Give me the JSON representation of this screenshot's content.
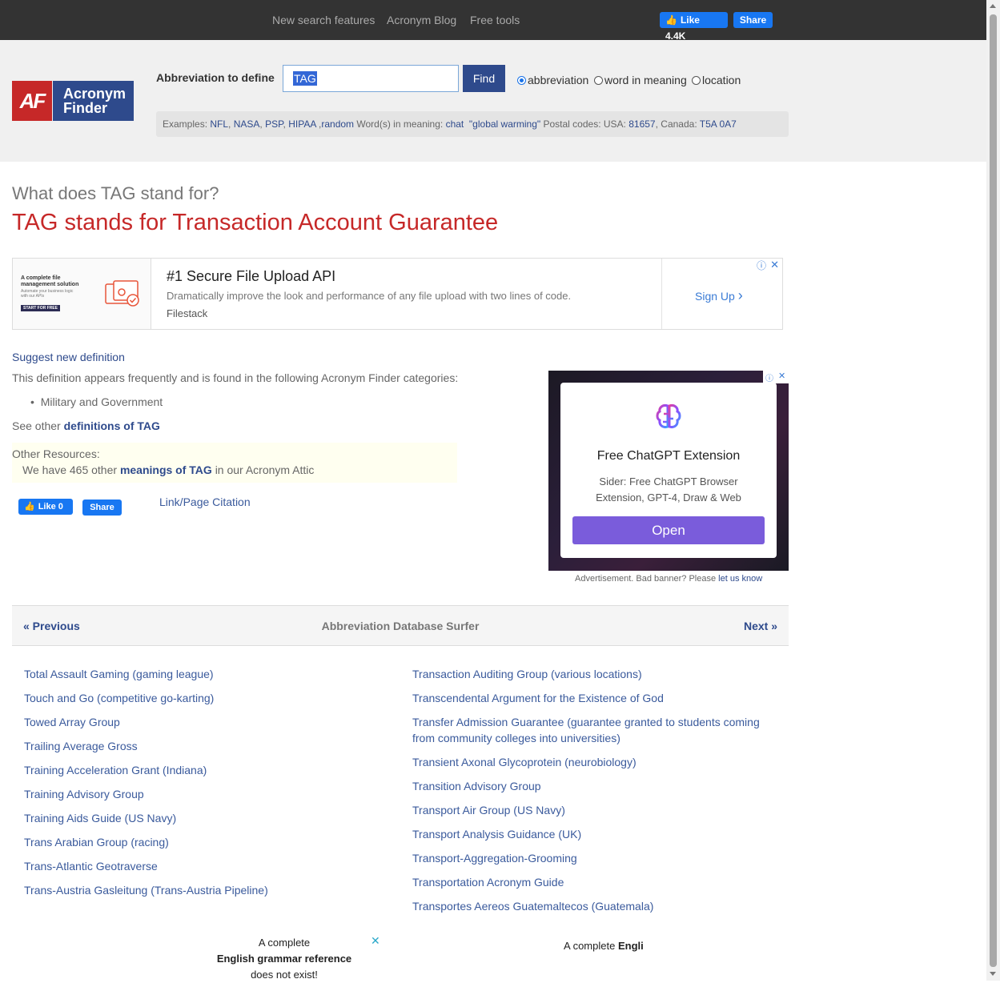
{
  "topnav": {
    "links": [
      "New search features",
      "Acronym Blog",
      "Free tools"
    ],
    "like_label": "Like 4.4K",
    "share_label": "Share"
  },
  "logo": {
    "mark": "AF",
    "name_line1": "Acronym",
    "name_line2": "Finder"
  },
  "search": {
    "label": "Abbreviation to define",
    "value": "TAG",
    "find_label": "Find",
    "radios": [
      {
        "label": "abbreviation",
        "checked": true
      },
      {
        "label": "word in meaning",
        "checked": false
      },
      {
        "label": "location",
        "checked": false
      }
    ],
    "examples": {
      "prefix": "Examples:",
      "abbr": [
        "NFL",
        "NASA",
        "PSP",
        "HIPAA"
      ],
      "random": "random",
      "meaning_prefix": "Word(s) in meaning:",
      "meaning": [
        "chat",
        "\"global warming\""
      ],
      "postal_prefix": "Postal codes: USA:",
      "usa_code": "81657",
      "canada_prefix": "Canada:",
      "canada_code": "T5A 0A7"
    }
  },
  "page": {
    "question": "What does TAG stand for?",
    "answer": "TAG stands for Transaction Account Guarantee",
    "suggest_link": "Suggest new definition",
    "categories_text": "This definition appears frequently and is found in the following Acronym Finder categories:",
    "categories": [
      "Military and Government"
    ],
    "see_other_prefix": "See other",
    "see_other_link": "definitions of TAG",
    "other_resources_label": "Other Resources:",
    "other_resources_prefix": "We have 465 other",
    "other_resources_link": "meanings of TAG",
    "other_resources_suffix": "in our Acronym Attic",
    "like_label": "Like 0",
    "share_label": "Share",
    "citation_link": "Link/Page Citation"
  },
  "ad1": {
    "thumb_text": "A complete file management solution",
    "thumb_sub": "Automate your business logic with our APIs",
    "thumb_button": "START FOR FREE",
    "title": "#1 Secure File Upload API",
    "description": "Dramatically improve the look and performance of any file upload with two lines of code.",
    "sponsor": "Filestack",
    "cta": "Sign Up"
  },
  "ad2": {
    "title": "Free ChatGPT Extension",
    "description": "Sider: Free ChatGPT Browser Extension, GPT-4, Draw & Web",
    "button": "Open",
    "notice_prefix": "Advertisement. Bad banner? Please",
    "notice_link": "let us know"
  },
  "surfer": {
    "prev": "« Previous",
    "title": "Abbreviation Database Surfer",
    "next": "Next »"
  },
  "list_left": [
    "Total Assault Gaming (gaming league)",
    "Touch and Go (competitive go-karting)",
    "Towed Array Group",
    "Trailing Average Gross",
    "Training Acceleration Grant (Indiana)",
    "Training Advisory Group",
    "Training Aids Guide (US Navy)",
    "Trans Arabian Group (racing)",
    "Trans-Atlantic Geotraverse",
    "Trans-Austria Gasleitung (Trans-Austria Pipeline)"
  ],
  "list_right": [
    "Transaction Auditing Group (various locations)",
    "Transcendental Argument for the Existence of God",
    "Transfer Admission Guarantee (guarantee granted to students coming from community colleges into universities)",
    "Transient Axonal Glycoprotein (neurobiology)",
    "Transition Advisory Group",
    "Transport Air Group (US Navy)",
    "Transport Analysis Guidance (UK)",
    "Transport-Aggregation-Grooming",
    "Transportation Acronym Guide",
    "Transportes Aereos Guatemaltecos (Guatemala)"
  ],
  "bottom_ads": {
    "left_line1": "A complete",
    "left_line2": "English grammar reference",
    "left_line3": "does not exist!",
    "right_prefix": "A complete",
    "right_bold": "Engli"
  },
  "colors": {
    "brand_red": "#c62828",
    "brand_blue": "#2e4a8c",
    "link": "#3a5a9c",
    "facebook": "#1877f2"
  }
}
